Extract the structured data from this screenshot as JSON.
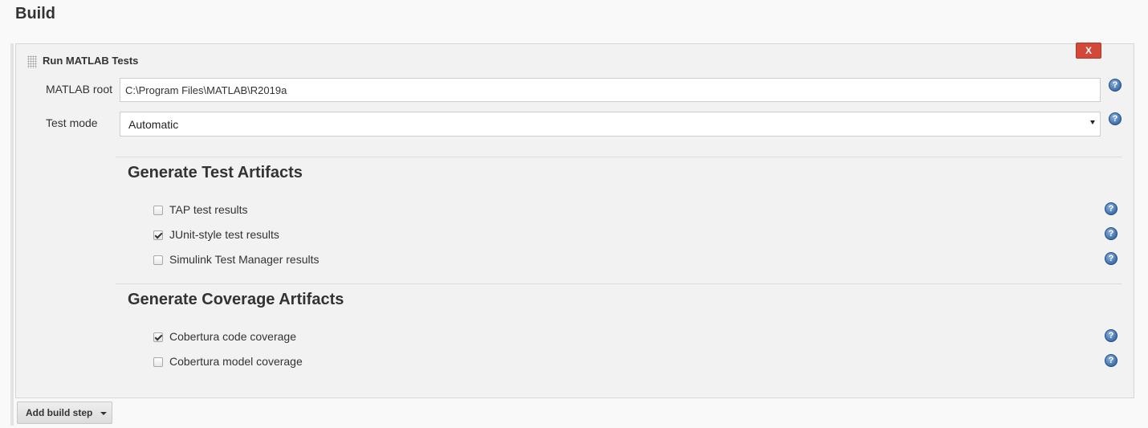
{
  "section": {
    "title": "Build"
  },
  "step": {
    "title": "Run MATLAB Tests",
    "delete_label": "X",
    "matlab_root": {
      "label": "MATLAB root",
      "value": "C:\\Program Files\\MATLAB\\R2019a"
    },
    "test_mode": {
      "label": "Test mode",
      "selected": "Automatic"
    }
  },
  "test_artifacts": {
    "title": "Generate Test Artifacts",
    "items": [
      {
        "label": "TAP test results",
        "checked": false
      },
      {
        "label": "JUnit-style test results",
        "checked": true
      },
      {
        "label": "Simulink Test Manager results",
        "checked": false
      }
    ]
  },
  "coverage_artifacts": {
    "title": "Generate Coverage Artifacts",
    "items": [
      {
        "label": "Cobertura code coverage",
        "checked": true
      },
      {
        "label": "Cobertura model coverage",
        "checked": false
      }
    ]
  },
  "help_icon": {
    "glyph": "?",
    "icon": "help-icon",
    "color": "#3f6fa9"
  },
  "add_build_step": {
    "label": "Add build step"
  },
  "colors": {
    "delete_button": "#d24939",
    "background": "#f9f9f9",
    "panel": "#f2f2f2"
  }
}
